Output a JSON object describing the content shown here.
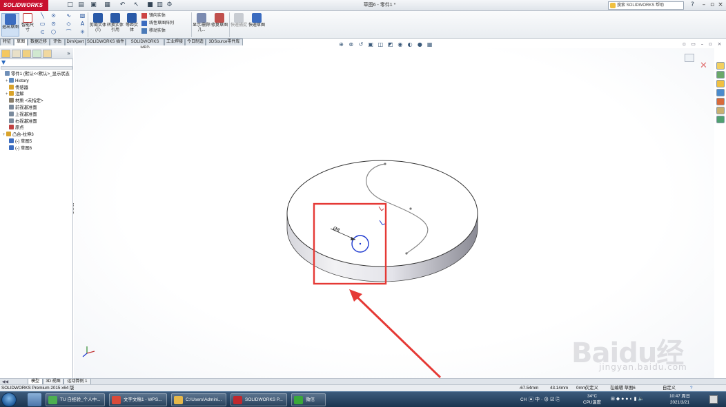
{
  "app": {
    "logo": "SOLIDWORKS",
    "document_title": "草图6 - 零件1 *",
    "search_placeholder": "搜索 SOLIDWORKS 帮助"
  },
  "commands": {
    "exit_sketch": "退出草图",
    "smart_dimension": "智能尺寸",
    "mirror_entities": "剪裁实体(T)",
    "convert_entities": "转换实体引用",
    "offset_entities": "等距实体",
    "mirror": "镜向实体",
    "linear_pattern": "线性草图阵列",
    "move": "移动实体",
    "display_delete_relations": "显示/删除几...",
    "repair_sketch": "修复草图",
    "quick_snaps": "快速捕捉",
    "rapid_sketch": "快速草图"
  },
  "tabs": [
    "特征",
    "草图",
    "数据迁移",
    "评估",
    "DimXpert",
    "SOLIDWORKS 插件",
    "SOLIDWORKS MBD",
    "工业焊接",
    "今日制造",
    "3DSource零件库"
  ],
  "active_tab": "草图",
  "tree": [
    {
      "label": "零件1 (默认<<默认>_显示状态",
      "icon": "part-icon",
      "color": "#6f8fb8"
    },
    {
      "label": "History",
      "icon": "history-icon",
      "color": "#5c8ac0"
    },
    {
      "label": "传感器",
      "icon": "sensor-icon",
      "color": "#d9a32b"
    },
    {
      "label": "注解",
      "icon": "annotation-icon",
      "color": "#d9a32b"
    },
    {
      "label": "材质 <未指定>",
      "icon": "material-icon",
      "color": "#8a7f6b"
    },
    {
      "label": "前视基准面",
      "icon": "plane-icon",
      "color": "#7a8a9c"
    },
    {
      "label": "上视基准面",
      "icon": "plane-icon",
      "color": "#7a8a9c"
    },
    {
      "label": "右视基准面",
      "icon": "plane-icon",
      "color": "#7a8a9c"
    },
    {
      "label": "原点",
      "icon": "origin-icon",
      "color": "#c04040"
    },
    {
      "label": "凸台-拉伸3",
      "icon": "extrude-icon",
      "color": "#d9a32b"
    },
    {
      "label": "(-) 草图5",
      "icon": "sketch-icon",
      "color": "#3b6cc0"
    },
    {
      "label": "(-) 草图6",
      "icon": "sketch-icon",
      "color": "#3b6cc0"
    }
  ],
  "sketch": {
    "dimension_text": "Ø8"
  },
  "model_tabs": [
    "模型",
    "3D 视图",
    "运动算例 1"
  ],
  "status": {
    "app_version": "SOLIDWORKS Premium 2015 x64 版",
    "x": "-67.54mm",
    "y": "43.14mm",
    "z": "0mm",
    "definition": "欠定义",
    "editing": "在编辑 草图6",
    "units": "自定义"
  },
  "taskbar": {
    "items": [
      "TU 白经验_个人中...",
      "文字文稿1 - WPS...",
      "C:\\Users\\Admini...",
      "SOLIDWORKS P...",
      "微信"
    ],
    "ime": "CH",
    "temp": "34°C",
    "cpu_label": "CPU温度",
    "time": "10:47 周日",
    "date": "2021/3/21"
  },
  "watermark": {
    "text": "Baidu经验",
    "sub": "jingyan.baidu.com"
  },
  "colors": {
    "logo_red": "#c8102e",
    "highlight_red": "#e53935",
    "circle_blue": "#1e3ad0",
    "taskbar": "#1c3550"
  }
}
